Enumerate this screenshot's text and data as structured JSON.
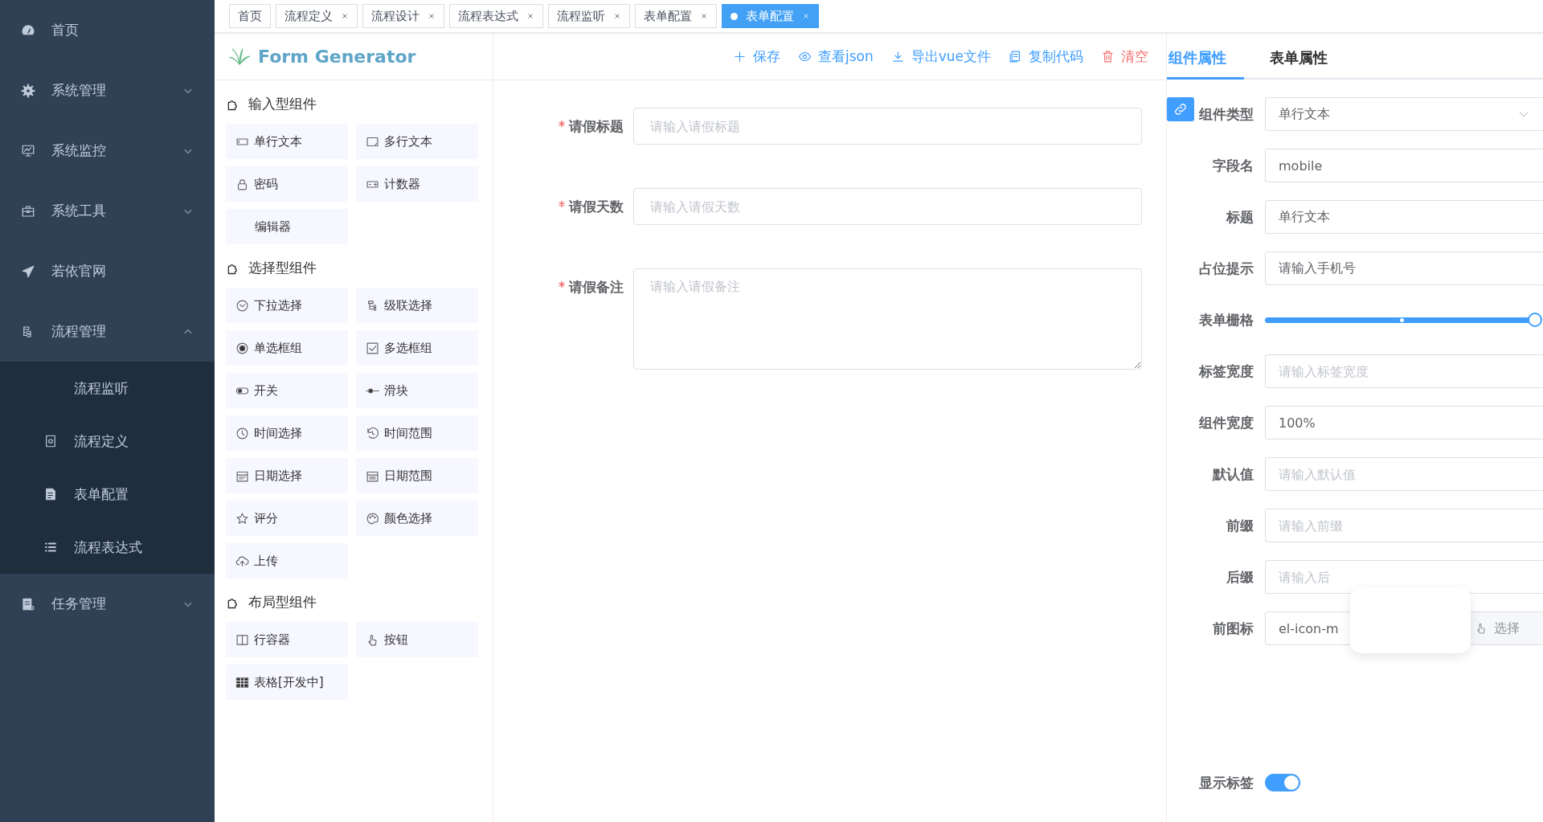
{
  "sidebar": {
    "items": [
      {
        "label": "首页",
        "kind": "link"
      },
      {
        "label": "系统管理",
        "kind": "menu",
        "expanded": false
      },
      {
        "label": "系统监控",
        "kind": "menu",
        "expanded": false
      },
      {
        "label": "系统工具",
        "kind": "menu",
        "expanded": false
      },
      {
        "label": "若依官网",
        "kind": "link"
      },
      {
        "label": "流程管理",
        "kind": "menu",
        "expanded": true,
        "children": [
          {
            "label": "流程监听"
          },
          {
            "label": "流程定义"
          },
          {
            "label": "表单配置"
          },
          {
            "label": "流程表达式"
          }
        ]
      },
      {
        "label": "任务管理",
        "kind": "menu",
        "expanded": false
      }
    ]
  },
  "tabs": [
    {
      "label": "首页",
      "selected": false,
      "closable": false
    },
    {
      "label": "流程定义",
      "selected": false,
      "closable": true
    },
    {
      "label": "流程设计",
      "selected": false,
      "closable": true
    },
    {
      "label": "流程表达式",
      "selected": false,
      "closable": true
    },
    {
      "label": "流程监听",
      "selected": false,
      "closable": true
    },
    {
      "label": "表单配置",
      "selected": false,
      "closable": true
    },
    {
      "label": "表单配置",
      "selected": true,
      "closable": true
    }
  ],
  "logo": {
    "title": "Form Generator"
  },
  "components": [
    {
      "title": "输入型组件",
      "items": [
        {
          "label": "单行文本"
        },
        {
          "label": "多行文本"
        },
        {
          "label": "密码"
        },
        {
          "label": "计数器"
        },
        {
          "label": "编辑器"
        }
      ]
    },
    {
      "title": "选择型组件",
      "items": [
        {
          "label": "下拉选择"
        },
        {
          "label": "级联选择"
        },
        {
          "label": "单选框组"
        },
        {
          "label": "多选框组"
        },
        {
          "label": "开关"
        },
        {
          "label": "滑块"
        },
        {
          "label": "时间选择"
        },
        {
          "label": "时间范围"
        },
        {
          "label": "日期选择"
        },
        {
          "label": "日期范围"
        },
        {
          "label": "评分"
        },
        {
          "label": "颜色选择"
        },
        {
          "label": "上传"
        }
      ]
    },
    {
      "title": "布局型组件",
      "items": [
        {
          "label": "行容器"
        },
        {
          "label": "按钮"
        },
        {
          "label": "表格[开发中]"
        }
      ]
    }
  ],
  "toolbar": [
    {
      "label": "保存",
      "kind": "normal"
    },
    {
      "label": "查看json",
      "kind": "normal"
    },
    {
      "label": "导出vue文件",
      "kind": "normal"
    },
    {
      "label": "复制代码",
      "kind": "normal"
    },
    {
      "label": "清空",
      "kind": "danger"
    }
  ],
  "form": {
    "fields": [
      {
        "label": "请假标题",
        "required": true,
        "kind": "input",
        "placeholder": "请输入请假标题"
      },
      {
        "label": "请假天数",
        "required": true,
        "kind": "input",
        "placeholder": "请输入请假天数"
      },
      {
        "label": "请假备注",
        "required": true,
        "kind": "textarea",
        "placeholder": "请输入请假备注"
      }
    ]
  },
  "properties": {
    "tabs": [
      {
        "label": "组件属性",
        "selected": true
      },
      {
        "label": "表单属性",
        "selected": false
      }
    ],
    "rows": [
      {
        "label": "组件类型",
        "kind": "select",
        "value": "单行文本"
      },
      {
        "label": "字段名",
        "kind": "input",
        "value": "mobile"
      },
      {
        "label": "标题",
        "kind": "input",
        "value": "单行文本"
      },
      {
        "label": "占位提示",
        "kind": "input",
        "value": "请输入手机号"
      },
      {
        "label": "表单栅格",
        "kind": "slider",
        "level": 1
      },
      {
        "label": "标签宽度",
        "kind": "input",
        "placeholder": "请输入标签宽度"
      },
      {
        "label": "组件宽度",
        "kind": "input",
        "value": "100%"
      },
      {
        "label": "默认值",
        "kind": "input",
        "placeholder": "请输入默认值"
      },
      {
        "label": "前缀",
        "kind": "input",
        "placeholder": "请输入前缀"
      },
      {
        "label": "后缀",
        "kind": "input",
        "placeholder": "请输入后"
      },
      {
        "label": "前图标",
        "kind": "append",
        "value": "el-icon-m",
        "button": "选择"
      },
      {
        "label": "显示标签",
        "kind": "switch",
        "on": true
      }
    ]
  }
}
